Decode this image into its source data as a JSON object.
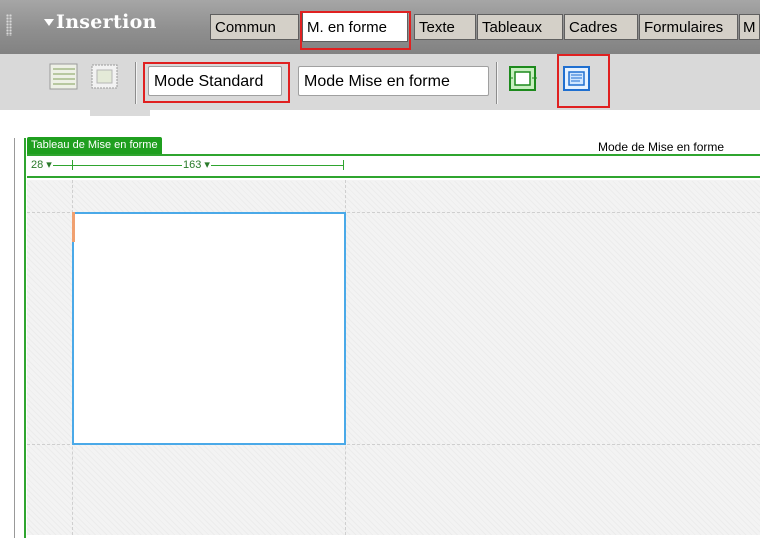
{
  "insert_panel": {
    "title": "Insertion",
    "tabs": [
      {
        "label": "Commun"
      },
      {
        "label": "M. en forme",
        "active": true
      },
      {
        "label": "Texte"
      },
      {
        "label": "Tableaux"
      },
      {
        "label": "Cadres"
      },
      {
        "label": "Formulaires"
      },
      {
        "label": "M"
      }
    ],
    "buttons": {
      "mode_standard": "Mode Standard",
      "mode_mise_en_forme": "Mode Mise en forme"
    },
    "icons": [
      "layout-table-icon",
      "layout-cell-icon",
      "layout-table-draw-icon",
      "layout-cell-draw-icon"
    ],
    "highlight_color": "#e02020"
  },
  "document": {
    "layout_table_tab": "Tableau de Mise en forme",
    "mode_label": "Mode de Mise en forme",
    "ruler": {
      "first_width": "28 ▾",
      "second_width": "163 ▾"
    },
    "accent_color": "#2fa52f",
    "cell_border_color": "#4aa9e8"
  }
}
